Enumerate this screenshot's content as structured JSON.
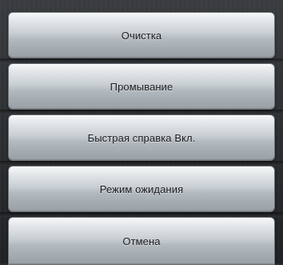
{
  "menu": {
    "items": [
      {
        "label": "Очистка"
      },
      {
        "label": "Промывание"
      },
      {
        "label": "Быстрая справка Вкл."
      },
      {
        "label": "Режим ожидания"
      },
      {
        "label": "Отмена"
      }
    ]
  },
  "colors": {
    "background": "#2b2e31",
    "button_top": "#f6f8f9",
    "button_bottom": "#9aa1a6",
    "text": "#1c1d1f"
  }
}
